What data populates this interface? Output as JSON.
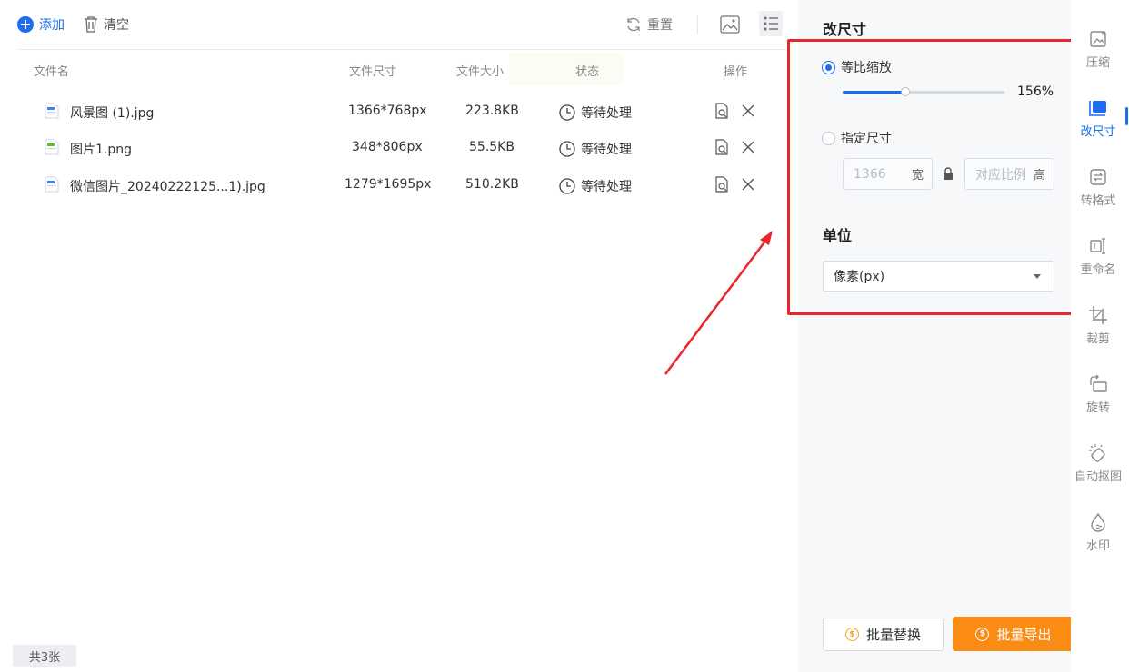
{
  "toolbar": {
    "add_label": "添加",
    "clear_label": "清空",
    "reset_label": "重置"
  },
  "table": {
    "headers": {
      "name": "文件名",
      "dimensions": "文件尺寸",
      "size": "文件大小",
      "status": "状态",
      "actions": "操作"
    },
    "rows": [
      {
        "name": "风景图 (1).jpg",
        "dimensions": "1366*768px",
        "size": "223.8KB",
        "status": "等待处理",
        "icon": "image-file-icon"
      },
      {
        "name": "图片1.png",
        "dimensions": "348*806px",
        "size": "55.5KB",
        "status": "等待处理",
        "icon": "image-file-icon"
      },
      {
        "name": "微信图片_20240222125...1).jpg",
        "dimensions": "1279*1695px",
        "size": "510.2KB",
        "status": "等待处理",
        "icon": "image-file-icon"
      }
    ]
  },
  "footer": {
    "count_label": "共3张"
  },
  "panel": {
    "title": "改尺寸",
    "option_scale": "等比缩放",
    "scale_percent": 156,
    "scale_value": "156%",
    "option_size": "指定尺寸",
    "width_placeholder": "1366",
    "width_unit": "宽",
    "height_placeholder": "对应比例",
    "height_unit": "高",
    "unit_title": "单位",
    "unit_selected": "像素(px)",
    "btn_replace": "批量替换",
    "btn_export": "批量导出",
    "accent_color": "#1b6ef3",
    "export_color": "#fa8c16",
    "highlight_color": "#e8262b"
  },
  "sidebar": {
    "items": [
      {
        "label": "压缩",
        "icon": "compress-icon"
      },
      {
        "label": "改尺寸",
        "icon": "resize-icon",
        "active": true
      },
      {
        "label": "转格式",
        "icon": "convert-format-icon"
      },
      {
        "label": "重命名",
        "icon": "rename-icon"
      },
      {
        "label": "裁剪",
        "icon": "crop-icon"
      },
      {
        "label": "旋转",
        "icon": "rotate-icon"
      },
      {
        "label": "自动抠图",
        "icon": "auto-cutout-icon"
      },
      {
        "label": "水印",
        "icon": "watermark-icon"
      }
    ]
  }
}
